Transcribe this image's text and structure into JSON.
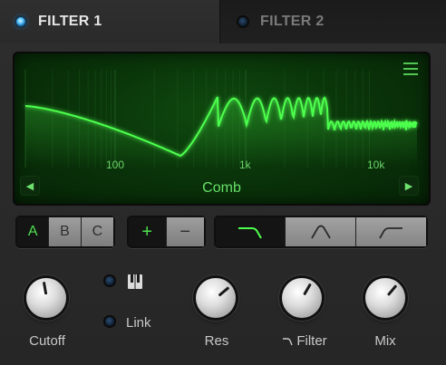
{
  "tabs": [
    {
      "label": "FILTER 1",
      "active": true
    },
    {
      "label": "FILTER 2",
      "active": false
    }
  ],
  "display": {
    "freq_labels": [
      "100",
      "1k",
      "10k"
    ],
    "mode": "Comb",
    "prev_arrow": "◀",
    "next_arrow": "▶",
    "accent_color": "#4dff4d"
  },
  "slot_buttons": [
    {
      "label": "A",
      "selected": true
    },
    {
      "label": "B",
      "selected": false
    },
    {
      "label": "C",
      "selected": false
    }
  ],
  "polarity_buttons": [
    {
      "label": "+",
      "selected": true
    },
    {
      "label": "−",
      "selected": false
    }
  ],
  "shape_buttons": [
    {
      "icon": "lowpass-shape-icon",
      "selected": true
    },
    {
      "icon": "bandpass-shape-icon",
      "selected": false
    },
    {
      "icon": "highpass-shape-icon",
      "selected": false
    }
  ],
  "keytrack": {
    "icon": "piano-keys-icon",
    "active": false
  },
  "link": {
    "label": "Link",
    "active": false
  },
  "knobs": [
    {
      "label": "Cutoff",
      "angle_deg": -10
    },
    {
      "label": "Res",
      "angle_deg": 50
    },
    {
      "label": "Filter",
      "angle_deg": 30,
      "prefix_icon": "lowpass-small-icon"
    },
    {
      "label": "Mix",
      "angle_deg": 40
    }
  ]
}
